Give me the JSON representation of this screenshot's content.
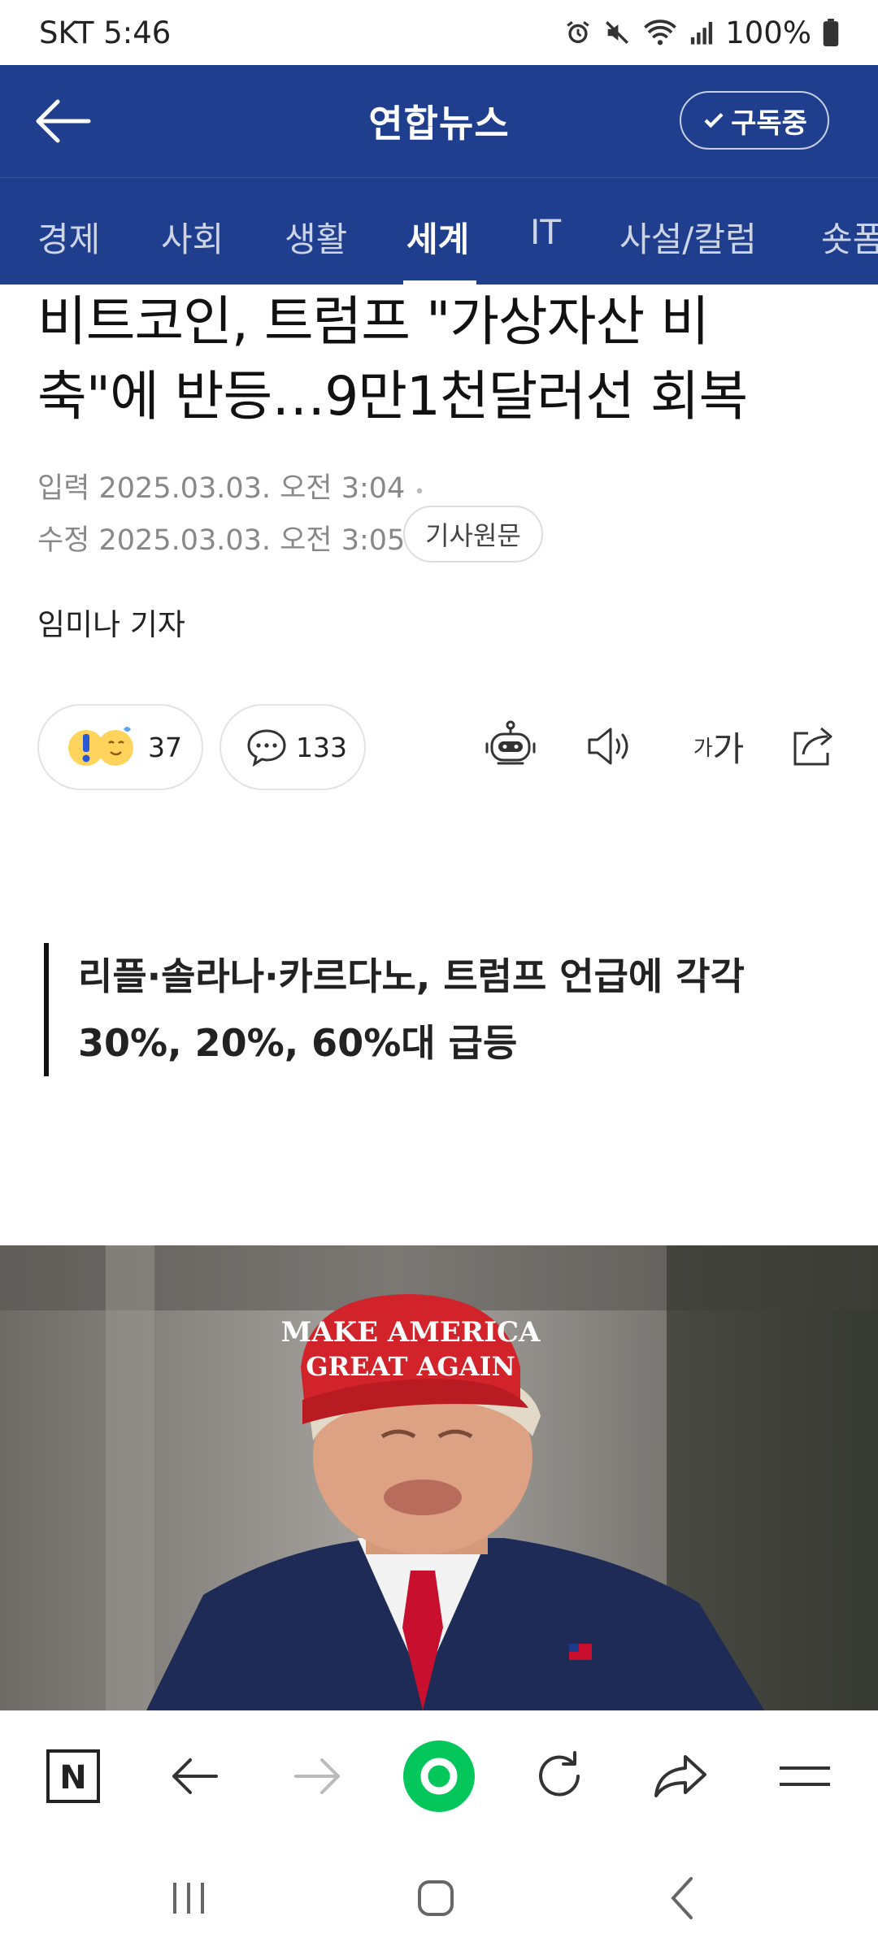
{
  "status_bar": {
    "carrier_time": "SKT 5:46",
    "battery": "100%"
  },
  "header": {
    "title": "연합뉴스",
    "subscribe_label": "구독중"
  },
  "tabs": [
    {
      "label": "경제"
    },
    {
      "label": "사회"
    },
    {
      "label": "생활"
    },
    {
      "label": "세계",
      "active": true
    },
    {
      "label": "IT"
    },
    {
      "label": "사설/칼럼"
    },
    {
      "label": "숏폼"
    }
  ],
  "article": {
    "title_line1": "비트코인, 트럼프 \"가상자산 비",
    "title_line2": "축\"에 반등…9만1천달러선 회복",
    "published": "입력 2025.03.03. 오전 3:04",
    "edited": "수정 2025.03.03. 오전 3:05",
    "original_label": "기사원문",
    "author": "임미나 기자",
    "reaction_count": "37",
    "comment_count": "133",
    "font_label_small": "가",
    "font_label_large": "가",
    "summary_line1": "리플·솔라나·카르다노, 트럼프 언급에 각각",
    "summary_line2": "30%, 20%, 60%대 급등",
    "photo_cap_line1": "MAKE AMERICA",
    "photo_cap_line2": "GREAT AGAIN"
  },
  "browser_bar": {
    "home_letter": "N"
  },
  "colors": {
    "brand_blue": "#1f3e8e",
    "accent_green": "#03c75a"
  }
}
